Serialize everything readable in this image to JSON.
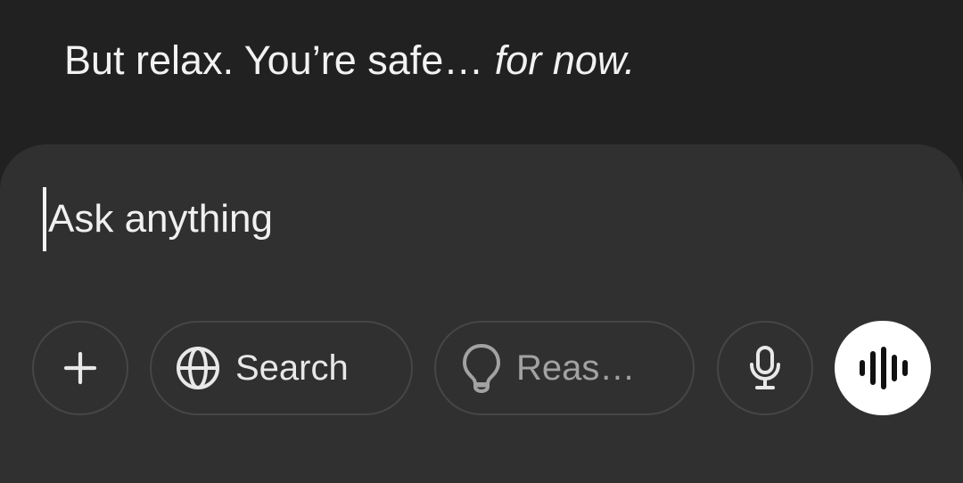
{
  "message": {
    "text": "But relax. You’re safe… ",
    "italic_text": "for now."
  },
  "composer": {
    "placeholder": "Ask anything",
    "buttons": {
      "add_icon": "plus-icon",
      "search_label": "Search",
      "search_icon": "globe-icon",
      "reason_label": "Reas…",
      "reason_icon": "lightbulb-icon",
      "mic_icon": "microphone-icon",
      "voice_icon": "voice-waveform-icon"
    }
  },
  "colors": {
    "background": "#212121",
    "composer": "#303030",
    "button_border": "#464646",
    "voice_button": "#ffffff"
  }
}
